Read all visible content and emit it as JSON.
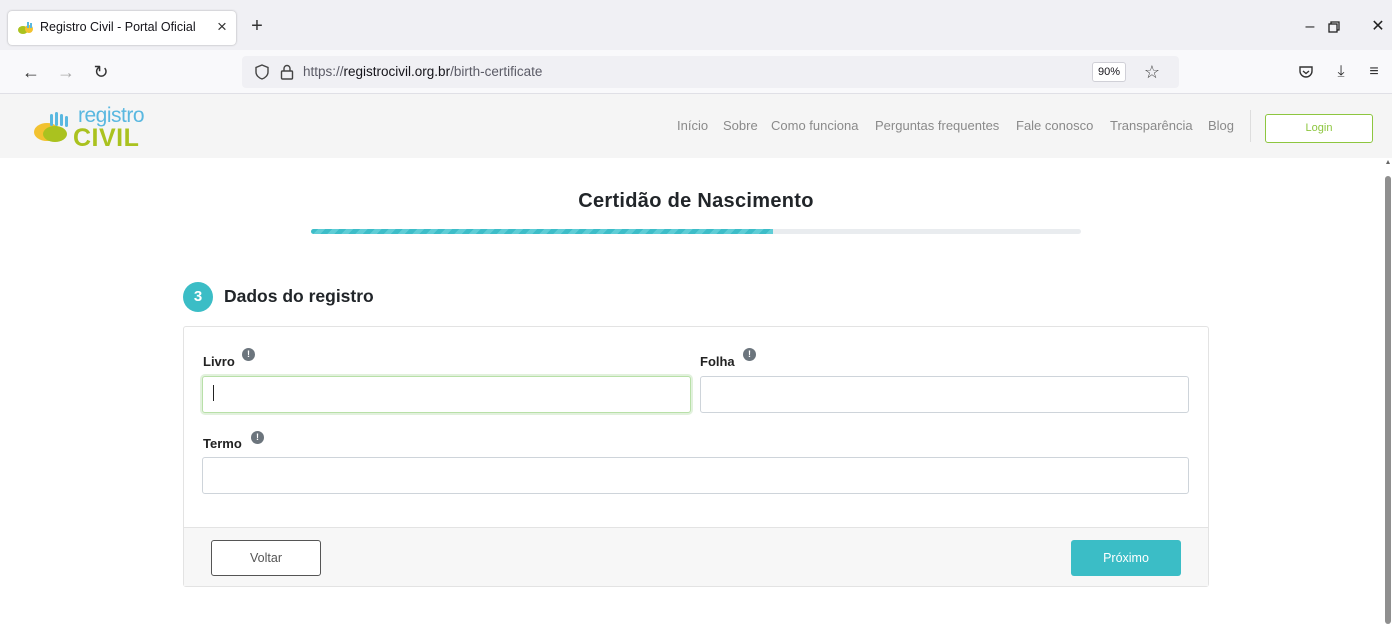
{
  "browser": {
    "tab_title": "Registro Civil - Portal Oficial",
    "new_tab": "+",
    "url_scheme": "https://",
    "url_host": "registrocivil.org.br",
    "url_path": "/birth-certificate",
    "zoom": "90%"
  },
  "site": {
    "logo_top": "registro",
    "logo_bottom": "CIVIL",
    "menu": [
      "Início",
      "Sobre",
      "Como funciona",
      "Perguntas frequentes",
      "Fale conosco",
      "Transparência",
      "Blog"
    ],
    "login_label": "Login"
  },
  "page": {
    "title": "Certidão de Nascimento",
    "progress_fraction": 0.6
  },
  "step": {
    "number": "3",
    "title": "Dados do registro"
  },
  "form": {
    "livro_label": "Livro",
    "livro_value": "",
    "folha_label": "Folha",
    "folha_value": "",
    "termo_label": "Termo",
    "termo_value": "",
    "back_label": "Voltar",
    "next_label": "Próximo"
  },
  "colors": {
    "accent": "#3bbdc6",
    "login_green": "#8dc63f"
  }
}
